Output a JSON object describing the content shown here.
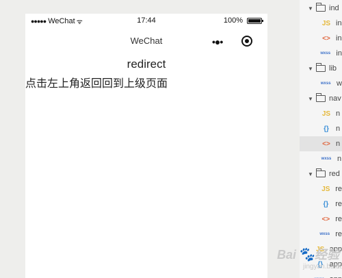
{
  "status_bar": {
    "carrier": "WeChat",
    "time": "17:44",
    "battery": "100%",
    "battery_level": 1.0
  },
  "nav_bar": {
    "title": "WeChat"
  },
  "page": {
    "heading": "redirect",
    "text": "点击左上角返回回到上级页面"
  },
  "file_tree": [
    {
      "kind": "folder",
      "label": "ind",
      "expanded": true
    },
    {
      "kind": "js",
      "icon_label": "JS",
      "label": "in"
    },
    {
      "kind": "wxml",
      "icon_label": "<>",
      "label": "in"
    },
    {
      "kind": "wxss",
      "icon_label": "wxss",
      "label": "in"
    },
    {
      "kind": "folder",
      "label": "lib",
      "expanded": true
    },
    {
      "kind": "wxss",
      "icon_label": "wxss",
      "label": "w"
    },
    {
      "kind": "folder",
      "label": "nav",
      "expanded": true
    },
    {
      "kind": "js",
      "icon_label": "JS",
      "label": "n"
    },
    {
      "kind": "json",
      "icon_label": "{}",
      "label": "n"
    },
    {
      "kind": "wxml",
      "icon_label": "<>",
      "label": "n",
      "selected": true
    },
    {
      "kind": "wxss",
      "icon_label": "wxss",
      "label": "n"
    },
    {
      "kind": "folder",
      "label": "red",
      "expanded": true
    },
    {
      "kind": "js",
      "icon_label": "JS",
      "label": "re"
    },
    {
      "kind": "json",
      "icon_label": "{}",
      "label": "re"
    },
    {
      "kind": "wxml",
      "icon_label": "<>",
      "label": "re"
    },
    {
      "kind": "wxss",
      "icon_label": "wxss",
      "label": "re"
    },
    {
      "kind": "js",
      "icon_label": "JS",
      "label": "app"
    },
    {
      "kind": "json",
      "icon_label": "{}",
      "label": "app"
    },
    {
      "kind": "wxss",
      "icon_label": "wxss",
      "label": "app"
    }
  ],
  "watermark": {
    "brand": "Bai",
    "suffix": "经验",
    "domain": "jingyan.baidu.com"
  },
  "colors": {
    "js": "#e5b83a",
    "json": "#3a8fd8",
    "wxml": "#e0653c",
    "wxss": "#3a6fc8"
  }
}
